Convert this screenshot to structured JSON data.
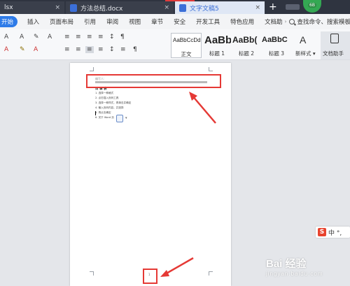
{
  "tabs": [
    {
      "label": "lsx",
      "icon": "excel-file-icon",
      "color": "#2e9b5b"
    },
    {
      "label": "方法总结.docx",
      "icon": "word-file-icon",
      "color": "#3b6fd8"
    },
    {
      "label": "文字文稿5",
      "icon": "word-file-icon",
      "color": "#3b6fd8",
      "active": true
    }
  ],
  "tab_close": "×",
  "new_tab": "+",
  "avatar_badge": "6B",
  "menu": [
    "开始",
    "插入",
    "页面布局",
    "引用",
    "审阅",
    "视图",
    "章节",
    "安全",
    "开发工具",
    "特色应用",
    "文档助"
  ],
  "menu_more": "›",
  "search_label": "查找命令、搜索模板",
  "ribbon": {
    "font_row": [
      "A",
      "A",
      "✎",
      "A"
    ],
    "para_row": [
      "≡",
      "≡",
      "≡",
      "≡",
      "≡",
      "↕",
      "¶"
    ],
    "styles": [
      {
        "sample": "AaBbCcDd",
        "name": "正文"
      },
      {
        "sample": "AaBb",
        "name": "标题 1"
      },
      {
        "sample": "AaBb(",
        "name": "标题 2"
      },
      {
        "sample": "AaBbC",
        "name": "标题 3"
      }
    ],
    "new_style": "新样式 ▾",
    "assistant": "文档助手"
  },
  "document": {
    "title_hint": "编写人:",
    "heading": "目 录 表",
    "items": [
      "1. 选择一种格式",
      "2. 点击插入页码工具",
      "3. 选择一种样式，再单击并确定",
      "4. 输入页码内容，并选择",
      "5. 再点击确定",
      "6. 关于 Word 页"
    ],
    "page_number": "1"
  },
  "ime": {
    "logo": "S",
    "text": "中 °,"
  },
  "watermark": {
    "main": "Bai 经验",
    "sub": "jingyan.baidu.com"
  },
  "colors": {
    "accent": "#2e7be8",
    "annotation": "#e53935",
    "tabbar": "#2f3440"
  }
}
